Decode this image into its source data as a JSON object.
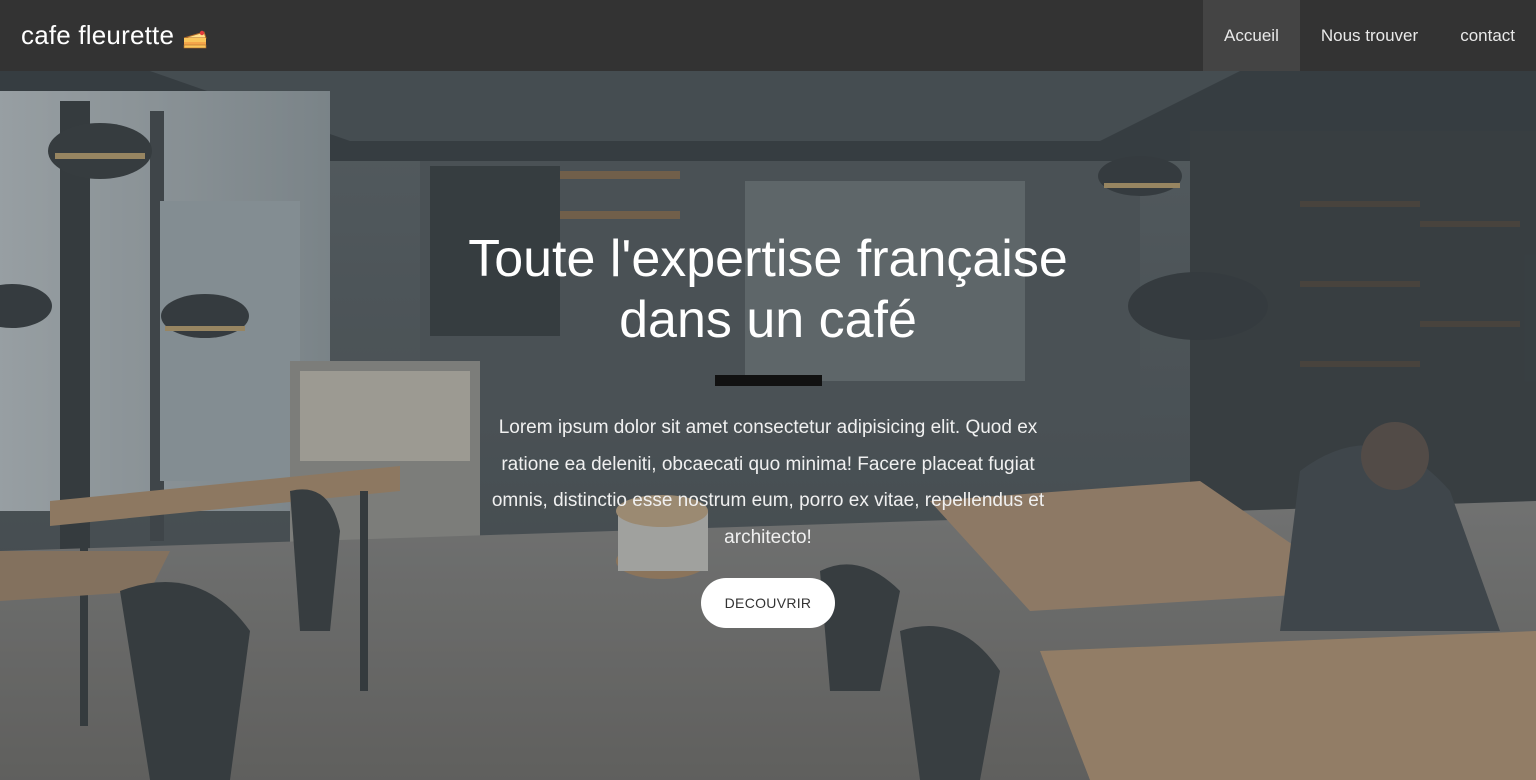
{
  "navbar": {
    "brand": "cafe fleurette",
    "brand_icon": "cake-slice-icon",
    "links": [
      {
        "label": "Accueil",
        "active": true
      },
      {
        "label": "Nous trouver",
        "active": false
      },
      {
        "label": "contact",
        "active": false
      }
    ],
    "background_color": "#333333",
    "active_color": "#444444"
  },
  "hero": {
    "title": "Toute l'expertise française dans un café",
    "text": "Lorem ipsum dolor sit amet consectetur adipisicing elit. Quod ex ratione ea deleniti, obcaecati quo minima! Facere placeat fugiat omnis, distinctio esse nostrum eum, porro ex vitae, repellendus et architecto!",
    "button": "DECOUVRIR",
    "background_image": "cafe-interior-photo",
    "divider_color": "#111111"
  }
}
